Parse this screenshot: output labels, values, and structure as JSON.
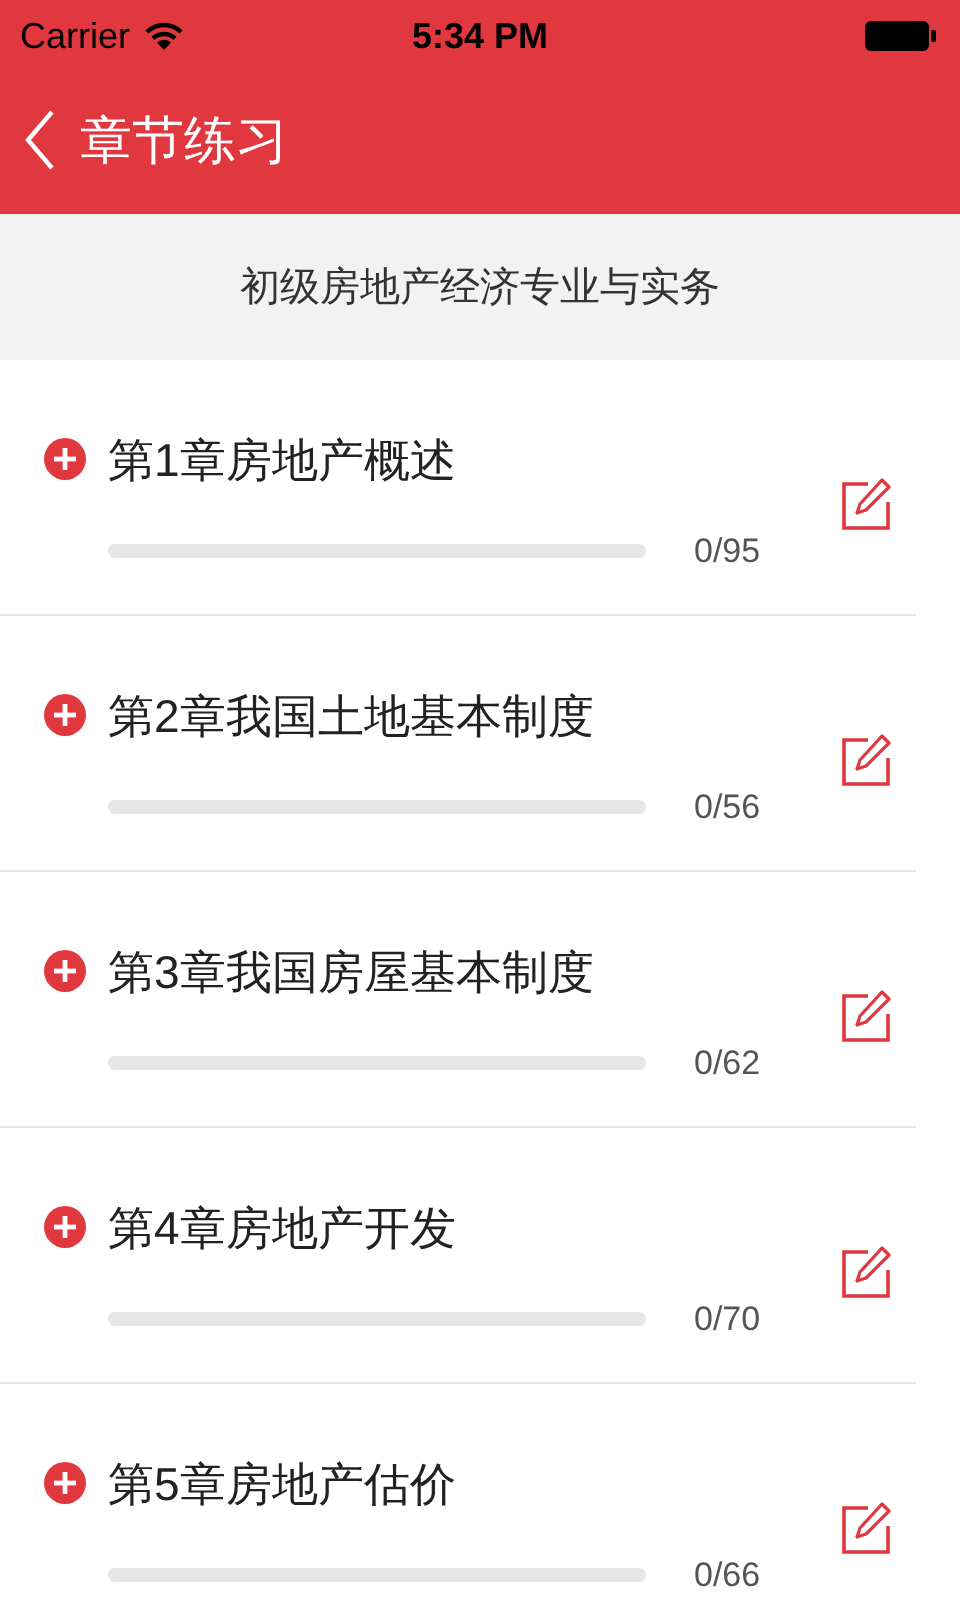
{
  "status_bar": {
    "carrier": "Carrier",
    "time": "5:34 PM"
  },
  "nav": {
    "title": "章节练习"
  },
  "subject": "初级房地产经济专业与实务",
  "chapters": [
    {
      "title": "第1章房地产概述",
      "expanded": false,
      "level": 0,
      "count": "0/95"
    },
    {
      "title": "第2章我国土地基本制度",
      "expanded": false,
      "level": 0,
      "count": "0/56"
    },
    {
      "title": "第3章我国房屋基本制度",
      "expanded": false,
      "level": 0,
      "count": "0/62"
    },
    {
      "title": "第4章房地产开发",
      "expanded": false,
      "level": 0,
      "count": "0/70"
    },
    {
      "title": "第5章房地产估价",
      "expanded": false,
      "level": 0,
      "count": "0/66"
    }
  ]
}
